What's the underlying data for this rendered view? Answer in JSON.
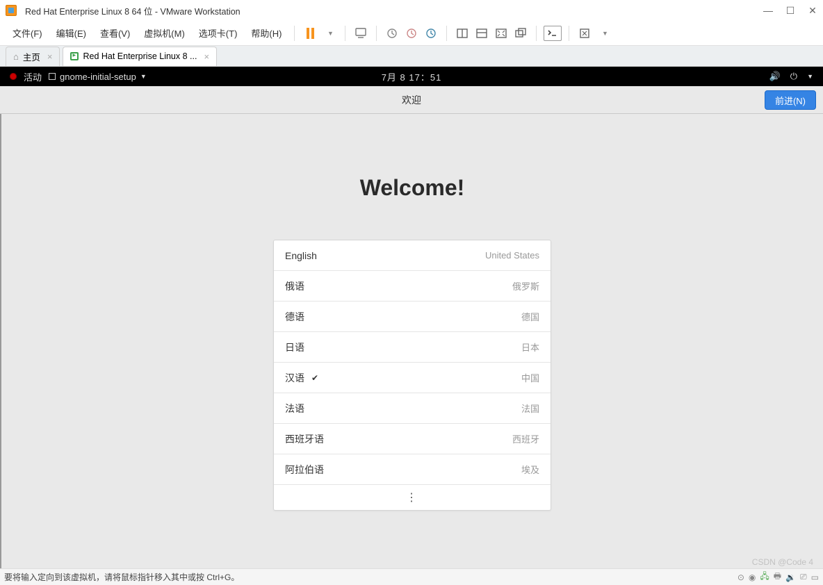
{
  "window": {
    "title": "Red Hat Enterprise Linux 8 64 位 - VMware Workstation"
  },
  "menu": {
    "file": "文件(F)",
    "edit": "编辑(E)",
    "view": "查看(V)",
    "vm": "虚拟机(M)",
    "tabs": "选项卡(T)",
    "help": "帮助(H)"
  },
  "tabs": {
    "home": "主页",
    "vm": "Red Hat Enterprise Linux 8 ..."
  },
  "gnome": {
    "activities": "活动",
    "app": "gnome-initial-setup",
    "clock": "7月 8 17：51"
  },
  "header": {
    "title": "欢迎",
    "next": "前进(N)"
  },
  "welcome": {
    "heading": "Welcome!",
    "languages": [
      {
        "name": "English",
        "region": "United States",
        "selected": false
      },
      {
        "name": "俄语",
        "region": "俄罗斯",
        "selected": false
      },
      {
        "name": "德语",
        "region": "德国",
        "selected": false
      },
      {
        "name": "日语",
        "region": "日本",
        "selected": false
      },
      {
        "name": "汉语",
        "region": "中国",
        "selected": true
      },
      {
        "name": "法语",
        "region": "法国",
        "selected": false
      },
      {
        "name": "西班牙语",
        "region": "西班牙",
        "selected": false
      },
      {
        "name": "阿拉伯语",
        "region": "埃及",
        "selected": false
      }
    ],
    "more": "⋮"
  },
  "statusbar": {
    "hint": "要将输入定向到该虚拟机，请将鼠标指针移入其中或按 Ctrl+G。"
  },
  "watermark": "CSDN @Code 4"
}
